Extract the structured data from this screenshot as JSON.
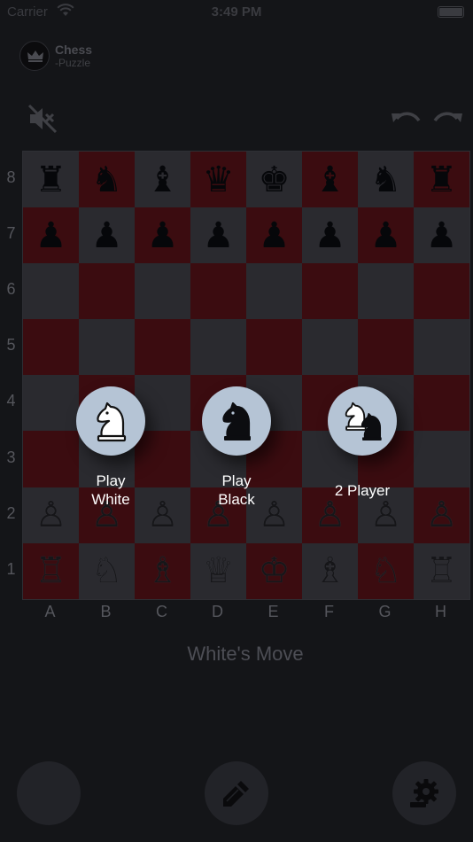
{
  "status_bar": {
    "carrier": "Carrier",
    "time": "3:49 PM",
    "wifi_icon": "wifi-icon",
    "battery_icon": "battery-icon"
  },
  "header": {
    "title": "Chess",
    "subtitle": "-Puzzle",
    "logo_icon": "crown-icon"
  },
  "toolbar": {
    "mute_icon": "speaker-muted-icon",
    "undo_icon": "undo-icon",
    "redo_icon": "redo-icon"
  },
  "board": {
    "files": [
      "A",
      "B",
      "C",
      "D",
      "E",
      "F",
      "G",
      "H"
    ],
    "ranks": [
      "8",
      "7",
      "6",
      "5",
      "4",
      "3",
      "2",
      "1"
    ],
    "rows": [
      [
        "♜",
        "♞",
        "♝",
        "♛",
        "♚",
        "♝",
        "♞",
        "♜"
      ],
      [
        "♟",
        "♟",
        "♟",
        "♟",
        "♟",
        "♟",
        "♟",
        "♟"
      ],
      [
        "",
        "",
        "",
        "",
        "",
        "",
        "",
        ""
      ],
      [
        "",
        "",
        "",
        "",
        "",
        "",
        "",
        ""
      ],
      [
        "",
        "",
        "",
        "",
        "",
        "",
        "",
        ""
      ],
      [
        "",
        "",
        "",
        "",
        "",
        "",
        "",
        ""
      ],
      [
        "♙",
        "♙",
        "♙",
        "♙",
        "♙",
        "♙",
        "♙",
        "♙"
      ],
      [
        "♖",
        "♘",
        "♗",
        "♕",
        "♔",
        "♗",
        "♘",
        "♖"
      ]
    ],
    "light_color": "#2a2a2f",
    "dark_color": "#3b0c10"
  },
  "mode_options": [
    {
      "id": "play-white",
      "line1": "Play",
      "line2": "White",
      "icon": "white-knight-icon"
    },
    {
      "id": "play-black",
      "line1": "Play",
      "line2": "Black",
      "icon": "black-knight-icon"
    },
    {
      "id": "two-player",
      "line1": "2 Player",
      "line2": "",
      "icon": "two-knights-icon"
    }
  ],
  "turn_text": "White's Move",
  "bottom_buttons": {
    "left_icon": "",
    "center_icon": "pencil-icon",
    "right_icon": "settings-gear-icon"
  },
  "colors": {
    "background": "#141518",
    "mode_circle": "#b5c4d5",
    "muted_text": "#4d4e55"
  }
}
